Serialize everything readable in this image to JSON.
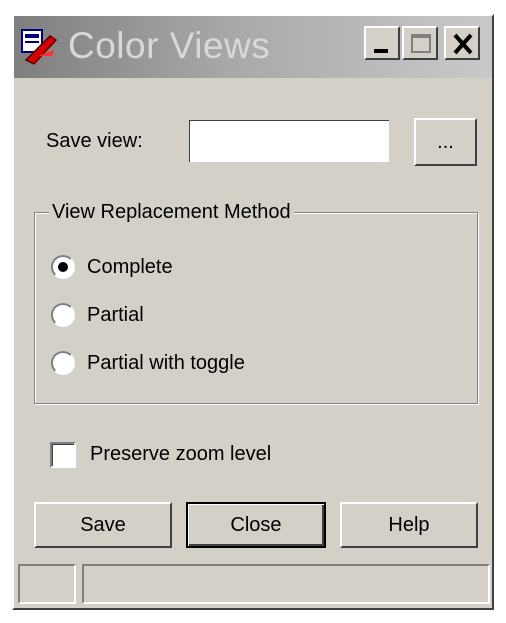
{
  "window": {
    "title": "Color Views",
    "icon": "color-views-app-icon",
    "controls": [
      "minimize-icon",
      "maximize-icon",
      "close-icon"
    ]
  },
  "save_view": {
    "label": "Save view:",
    "value": "",
    "placeholder": "",
    "browse_label": "..."
  },
  "replacement": {
    "legend": "View Replacement Method",
    "options": [
      {
        "label": "Complete",
        "selected": true
      },
      {
        "label": "Partial",
        "selected": false
      },
      {
        "label": "Partial with toggle",
        "selected": false
      }
    ]
  },
  "preserve_zoom": {
    "label": "Preserve zoom level",
    "checked": false
  },
  "buttons": {
    "save": "Save",
    "close": "Close",
    "help": "Help"
  },
  "status_bar": {
    "left": "",
    "right": ""
  },
  "colors": {
    "dialog_bg": "#d4d0c8",
    "title_gradient_start": "#7f7f7f",
    "title_text": "#d8d8d8"
  }
}
